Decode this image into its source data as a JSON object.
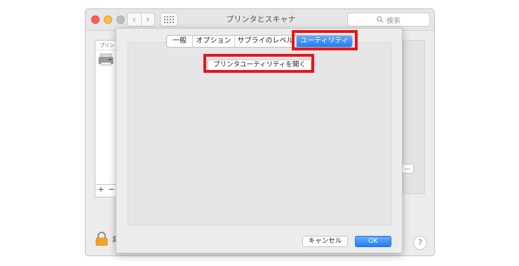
{
  "window": {
    "title": "プリンタとスキャナ",
    "search_placeholder": "検索",
    "nav_back": "‹",
    "nav_forward": "›",
    "list_header": "プリン",
    "add_label": "+",
    "remove_label": "−",
    "options_button_label": "...",
    "lock_text_partial": "変",
    "help_label": "?"
  },
  "sheet": {
    "tabs": [
      {
        "label": "一般",
        "active": false
      },
      {
        "label": "オプション",
        "active": false
      },
      {
        "label": "サプライのレベル",
        "active": false
      },
      {
        "label": "ユーティリティ",
        "active": true
      }
    ],
    "open_utility_label": "プリンタユーティリティを開く",
    "cancel_label": "キャンセル",
    "ok_label": "OK"
  },
  "colors": {
    "highlight": "#e8141b",
    "accent": "#1e7ef3",
    "close": "#fc605c",
    "minimize": "#fdbc40"
  },
  "icons": [
    "search-icon",
    "grid-icon",
    "printer-icon",
    "lock-icon",
    "help-icon",
    "chevron-left-icon",
    "chevron-right-icon"
  ]
}
